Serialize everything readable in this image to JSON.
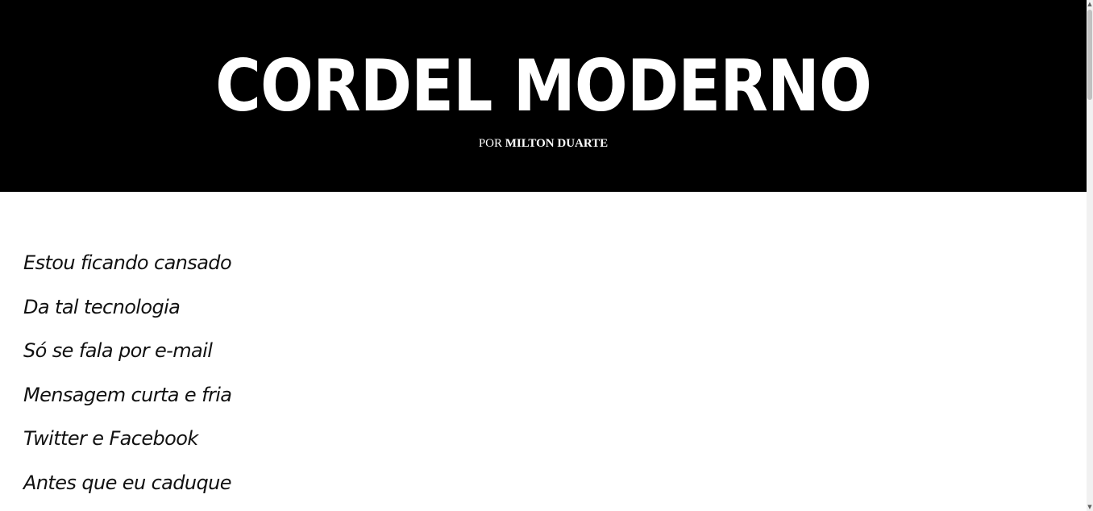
{
  "header": {
    "title": "CORDEL MODERNO",
    "byline_prefix": "POR ",
    "author": "MILTON DUARTE"
  },
  "poem": {
    "verses": [
      "Estou ficando cansado",
      "Da tal tecnologia",
      "Só se fala por e-mail",
      "Mensagem curta e fria",
      "Twitter e Facebook",
      "Antes que eu caduque"
    ]
  },
  "scrollbar": {
    "up_icon": "chevron-up-icon",
    "down_icon": "chevron-down-icon"
  },
  "colors": {
    "header_background": "#000000",
    "header_text": "#ffffff",
    "body_background": "#ffffff",
    "body_text": "#111111"
  }
}
